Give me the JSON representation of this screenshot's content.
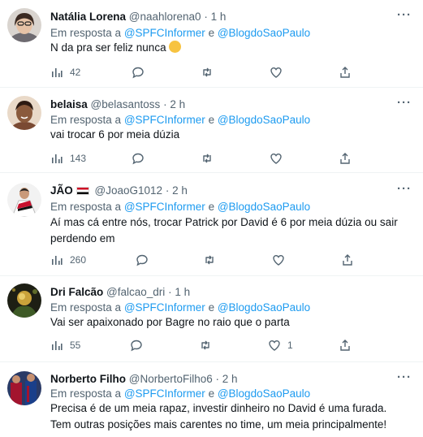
{
  "tweets": [
    {
      "name": "Natália Lorena",
      "handle": "@naahlorena0",
      "time": "1 h",
      "reply_prefix": "Em resposta a",
      "reply_user1": "@SPFCInformer",
      "reply_joiner": "e",
      "reply_user2": "@BlogdoSaoPaulo",
      "text": "N da pra ser feliz nunca",
      "views": "42",
      "likes": ""
    },
    {
      "name": "belaisa",
      "handle": "@belasantoss",
      "time": "2 h",
      "reply_prefix": "Em resposta a",
      "reply_user1": "@SPFCInformer",
      "reply_joiner": "e",
      "reply_user2": "@BlogdoSaoPaulo",
      "text": "vai trocar 6 por meia dúzia",
      "views": "143",
      "likes": ""
    },
    {
      "name": "JÃO",
      "handle": "@JoaoG1012",
      "time": "2 h",
      "reply_prefix": "Em resposta a",
      "reply_user1": "@SPFCInformer",
      "reply_joiner": "e",
      "reply_user2": "@BlogdoSaoPaulo",
      "text": "Aí mas cá entre nós, trocar Patrick por David é 6 por meia dúzia ou sair perdendo em",
      "views": "260",
      "likes": ""
    },
    {
      "name": "Dri Falcão",
      "handle": "@falcao_dri",
      "time": "1 h",
      "reply_prefix": "Em resposta a",
      "reply_user1": "@SPFCInformer",
      "reply_joiner": "e",
      "reply_user2": "@BlogdoSaoPaulo",
      "text": "Vai ser apaixonado por Bagre no raio que o parta",
      "views": "55",
      "likes": "1"
    },
    {
      "name": "Norberto Filho",
      "handle": "@NorbertoFilho6",
      "time": "2 h",
      "reply_prefix": "Em resposta a",
      "reply_user1": "@SPFCInformer",
      "reply_joiner": "e",
      "reply_user2": "@BlogdoSaoPaulo",
      "text": "Precisa é de um meia rapaz, investir dinheiro no David é uma furada. Tem outras posições mais carentes no time, um meia principalmente!",
      "views": "",
      "likes": ""
    }
  ],
  "separator": "·",
  "more_icon": "ellipsis-icon",
  "colors": {
    "link": "#1d9bf0",
    "muted": "#536471",
    "divider": "#eff3f4",
    "text": "#0f1419"
  }
}
